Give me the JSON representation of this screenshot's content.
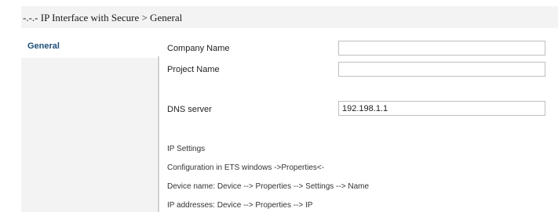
{
  "header": {
    "title": "-.-.- IP Interface with Secure > General"
  },
  "sidebar": {
    "items": [
      {
        "label": "General"
      }
    ]
  },
  "form": {
    "company_name": {
      "label": "Company Name",
      "value": ""
    },
    "project_name": {
      "label": "Project Name",
      "value": ""
    },
    "dns_server": {
      "label": "DNS server",
      "value": "192.198.1.1"
    }
  },
  "info": {
    "heading": "IP Settings",
    "lines": [
      "Configuration in ETS windows ->Properties<-",
      "Device name:  Device --> Properties --> Settings --> Name",
      "IP addresses: Device --> Properties --> IP"
    ]
  }
}
